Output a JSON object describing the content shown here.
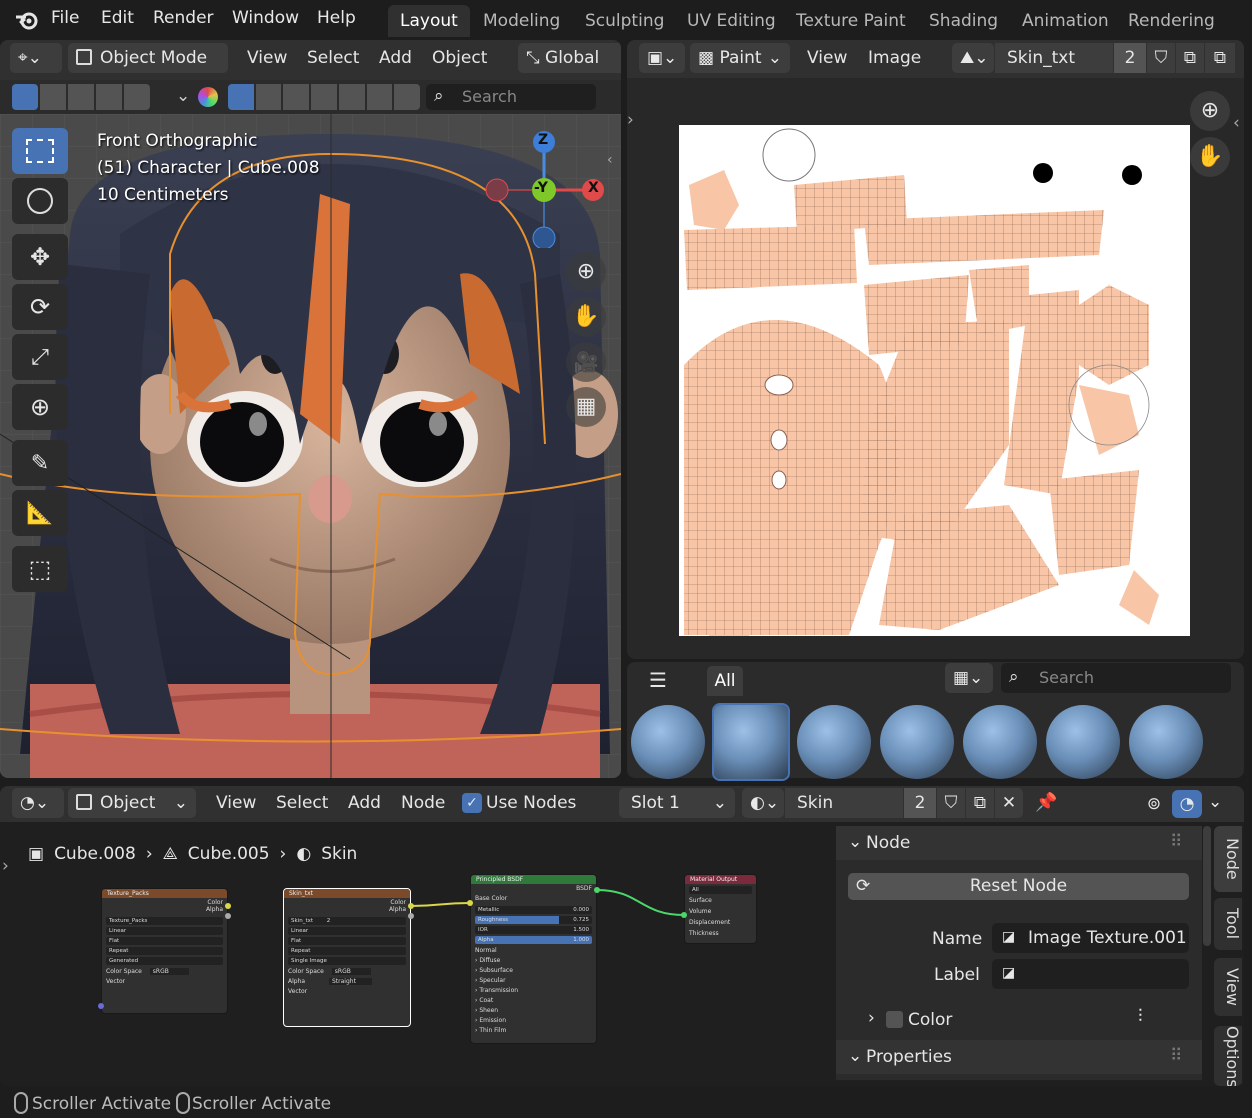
{
  "menu": [
    "File",
    "Edit",
    "Render",
    "Window",
    "Help"
  ],
  "workspace_tabs": [
    "Layout",
    "Modeling",
    "Sculpting",
    "UV Editing",
    "Texture Paint",
    "Shading",
    "Animation",
    "Rendering"
  ],
  "viewport": {
    "mode": "Object Mode",
    "menus": [
      "View",
      "Select",
      "Add",
      "Object"
    ],
    "transform": "Global",
    "search_placeholder": "Search",
    "overlay_line1": "Front Orthographic",
    "overlay_line2": "(51) Character | Cube.008",
    "overlay_line3": "10 Centimeters",
    "gizmo": {
      "z": "Z",
      "y": "-Y",
      "x": "X"
    }
  },
  "image_editor": {
    "mode": "Paint",
    "menus": [
      "View",
      "Image"
    ],
    "image_name": "Skin_txt",
    "users": "2"
  },
  "brush_panel": {
    "tab": "All",
    "search_placeholder": "Search"
  },
  "node_editor": {
    "type": "Object",
    "menus": [
      "View",
      "Select",
      "Add",
      "Node"
    ],
    "use_nodes": "Use Nodes",
    "slot": "Slot 1",
    "material": "Skin",
    "material_users": "2",
    "breadcrumb": [
      "Cube.008",
      "Cube.005",
      "Skin"
    ]
  },
  "nodes": {
    "tex1": {
      "title": "Texture_Packs",
      "out_color": "Color",
      "out_alpha": "Alpha",
      "image": "Texture_Packs",
      "interp": "Linear",
      "proj": "Flat",
      "ext": "Repeat",
      "source": "Generated",
      "cs_label": "Color Space",
      "cs": "sRGB",
      "vector": "Vector"
    },
    "tex2": {
      "title": "Skin_txt",
      "out_color": "Color",
      "out_alpha": "Alpha",
      "image": "Skin_txt",
      "users": "2",
      "interp": "Linear",
      "proj": "Flat",
      "ext": "Repeat",
      "source": "Single Image",
      "cs_label": "Color Space",
      "cs": "sRGB",
      "alpha_label": "Alpha",
      "alpha": "Straight",
      "vector": "Vector"
    },
    "bsdf": {
      "title": "Principled BSDF",
      "out": "BSDF",
      "base": "Base Color",
      "metallic": "Metallic",
      "metallic_v": "0.000",
      "roughness": "Roughness",
      "roughness_v": "0.725",
      "ior": "IOR",
      "ior_v": "1.500",
      "alpha": "Alpha",
      "alpha_v": "1.000",
      "normal": "Normal",
      "sections": [
        "Diffuse",
        "Subsurface",
        "Specular",
        "Transmission",
        "Coat",
        "Sheen",
        "Emission",
        "Thin Film"
      ]
    },
    "out": {
      "title": "Material Output",
      "target": "All",
      "surface": "Surface",
      "volume": "Volume",
      "displacement": "Displacement",
      "thickness": "Thickness"
    }
  },
  "sidebar": {
    "node_header": "Node",
    "reset": "Reset Node",
    "name_label": "Name",
    "name_value": "Image Texture.001",
    "label_label": "Label",
    "label_value": "",
    "color": "Color",
    "properties": "Properties",
    "tabs": [
      "Node",
      "Tool",
      "View",
      "Options"
    ]
  },
  "status": [
    "Scroller Activate",
    "Scroller Activate"
  ]
}
